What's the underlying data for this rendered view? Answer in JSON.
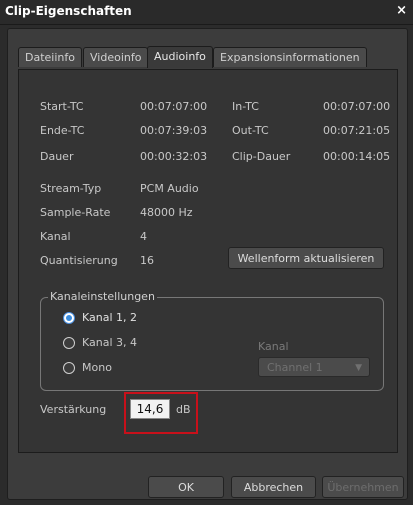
{
  "window": {
    "title": "Clip-Eigenschaften",
    "close_glyph": "×"
  },
  "tabs": [
    {
      "label": "Dateiinfo",
      "active": false
    },
    {
      "label": "Videoinfo",
      "active": false
    },
    {
      "label": "Audioinfo",
      "active": true
    },
    {
      "label": "Expansionsinformationen",
      "active": false
    }
  ],
  "info": {
    "start_tc_label": "Start-TC",
    "start_tc": "00:07:07:00",
    "in_tc_label": "In-TC",
    "in_tc": "00:07:07:00",
    "end_tc_label": "Ende-TC",
    "end_tc": "00:07:39:03",
    "out_tc_label": "Out-TC",
    "out_tc": "00:07:21:05",
    "duration_label": "Dauer",
    "duration": "00:00:32:03",
    "clip_duration_label": "Clip-Dauer",
    "clip_duration": "00:00:14:05",
    "stream_type_label": "Stream-Typ",
    "stream_type": "PCM Audio",
    "sample_rate_label": "Sample-Rate",
    "sample_rate": "48000 Hz",
    "channel_label": "Kanal",
    "channel": "4",
    "quantization_label": "Quantisierung",
    "quantization": "16"
  },
  "waveform_button": "Wellenform aktualisieren",
  "channel_settings": {
    "title": "Kanaleinstellungen",
    "options": [
      "Kanal 1, 2",
      "Kanal 3, 4",
      "Mono"
    ],
    "selected": 0,
    "channel_label": "Kanal",
    "channel_value": "Channel 1"
  },
  "gain": {
    "label": "Verstärkung",
    "value": "14,6",
    "unit": "dB"
  },
  "buttons": {
    "ok": "OK",
    "cancel": "Abbrechen",
    "apply": "Übernehmen"
  },
  "colors": {
    "highlight": "#c8101a",
    "radio_selected": "#3a8de0"
  }
}
